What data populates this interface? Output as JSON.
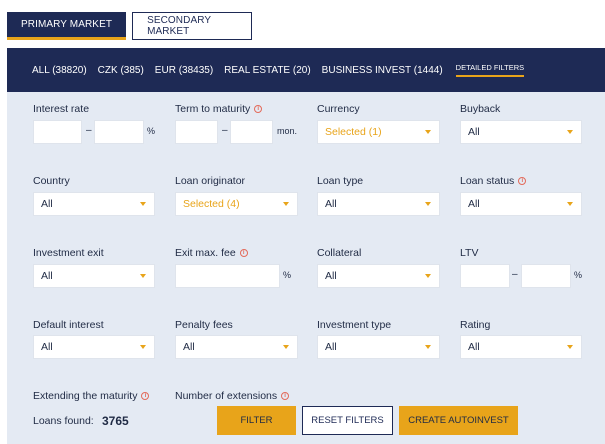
{
  "tabs": {
    "primary": "PRIMARY MARKET",
    "secondary": "SECONDARY MARKET"
  },
  "filter_bar": {
    "items": [
      "ALL (38820)",
      "CZK (385)",
      "EUR (38435)",
      "REAL ESTATE (20)",
      "BUSINESS INVEST (1444)"
    ],
    "detailed": "DETAILED FILTERS"
  },
  "filters": {
    "interest_rate": {
      "label": "Interest rate",
      "dash": "–",
      "unit": "%"
    },
    "term": {
      "label": "Term to maturity",
      "dash": "–",
      "unit": "mon."
    },
    "currency": {
      "label": "Currency",
      "value": "Selected (1)"
    },
    "buyback": {
      "label": "Buyback",
      "value": "All"
    },
    "country": {
      "label": "Country",
      "value": "All"
    },
    "loan_originator": {
      "label": "Loan originator",
      "value": "Selected (4)"
    },
    "loan_type": {
      "label": "Loan type",
      "value": "All"
    },
    "loan_status": {
      "label": "Loan status",
      "value": "All"
    },
    "investment_exit": {
      "label": "Investment exit",
      "value": "All"
    },
    "exit_fee": {
      "label": "Exit max. fee",
      "unit": "%"
    },
    "collateral": {
      "label": "Collateral",
      "value": "All"
    },
    "ltv": {
      "label": "LTV",
      "dash": "–",
      "unit": "%"
    },
    "default_interest": {
      "label": "Default interest",
      "value": "All"
    },
    "penalty_fees": {
      "label": "Penalty fees",
      "value": "All"
    },
    "investment_type": {
      "label": "Investment type",
      "value": "All"
    },
    "rating": {
      "label": "Rating",
      "value": "All"
    },
    "extending": {
      "label": "Extending the maturity"
    },
    "extensions": {
      "label": "Number of extensions"
    }
  },
  "info_glyph": "i",
  "results": {
    "label": "Loans found:",
    "count": "3765"
  },
  "buttons": {
    "filter": "FILTER",
    "reset": "RESET FILTERS",
    "autoinvest": "CREATE AUTOINVEST"
  },
  "colors": {
    "navy": "#1e2a55",
    "accent": "#e8a41a",
    "panel": "#e4eaf3",
    "info": "#e36a5a"
  }
}
